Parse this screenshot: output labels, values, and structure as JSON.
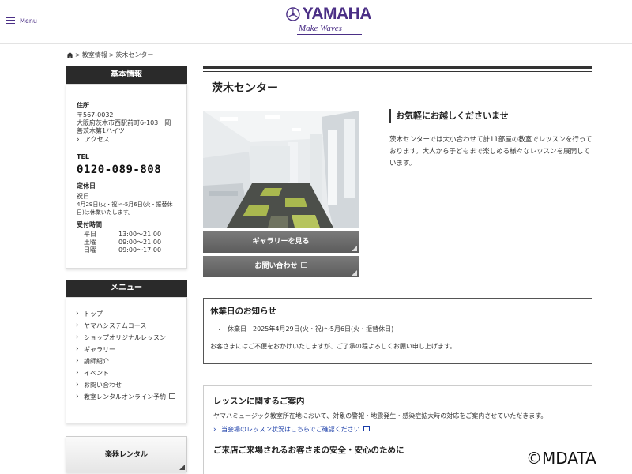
{
  "header": {
    "menu_label": "Menu",
    "logo_word": "YAMAHA",
    "logo_tagline": "Make Waves"
  },
  "breadcrumb": {
    "sep": ">",
    "items": [
      "教室情報",
      "茨木センター"
    ]
  },
  "sidebar": {
    "info": {
      "heading": "基本情報",
      "address_label": "住所",
      "postal": "〒567-0032",
      "address": "大阪府茨木市西駅前町6-103　岡善茨木第1ハイツ",
      "access_link": "アクセス",
      "tel_label": "TEL",
      "tel": "0120-089-808",
      "closed_label": "定休日",
      "closed_value": "祝日",
      "closed_note": "4月29日(火・祝)〜5月6日(火・振替休日)は休業いたします。",
      "hours_label": "受付時間",
      "hours": [
        {
          "day": "平日",
          "time": "13:00〜21:00"
        },
        {
          "day": "土曜",
          "time": "09:00〜21:00"
        },
        {
          "day": "日曜",
          "time": "09:00〜17:00"
        }
      ]
    },
    "menu": {
      "heading": "メニュー",
      "items": [
        "トップ",
        "ヤマハシステムコース",
        "ショップオリジナルレッスン",
        "ギャラリー",
        "講師紹介",
        "イベント",
        "お問い合わせ",
        "教室レンタルオンライン予約"
      ]
    },
    "rental_button": "楽器レンタル"
  },
  "main": {
    "title": "茨木センター",
    "gallery_button": "ギャラリーを見る",
    "contact_button": "お問い合わせ",
    "welcome_heading": "お気軽にお越しくださいませ",
    "welcome_text": "茨木センターでは大小合わせて計11部屋の教室でレッスンを行っております。大人から子どもまで楽しめる様々なレッスンを展開しています。",
    "notice": {
      "heading": "休業日のお知らせ",
      "items": [
        "休業日　2025年4月29日(火・祝)〜5月6日(火・振替休日)"
      ],
      "text": "お客さまにはご不便をおかけいたしますが、ご了承の程よろしくお願い申し上げます。"
    },
    "lesson": {
      "heading": "レッスンに関するご案内",
      "text": "ヤマハミュージック教室所在地において、対象の警報・地震発生・感染症拡大時の対応をご案内させていただきます。",
      "link": "当会場のレッスン状況はこちらでご確認ください",
      "subheading": "ご来店ご来場されるお客さまの安全・安心のために"
    }
  },
  "watermark": "©MDATA",
  "colors": {
    "brand": "#4b2f86",
    "dark": "#2a2a2a",
    "button_gray": "#666666",
    "link": "#1a3da8"
  }
}
